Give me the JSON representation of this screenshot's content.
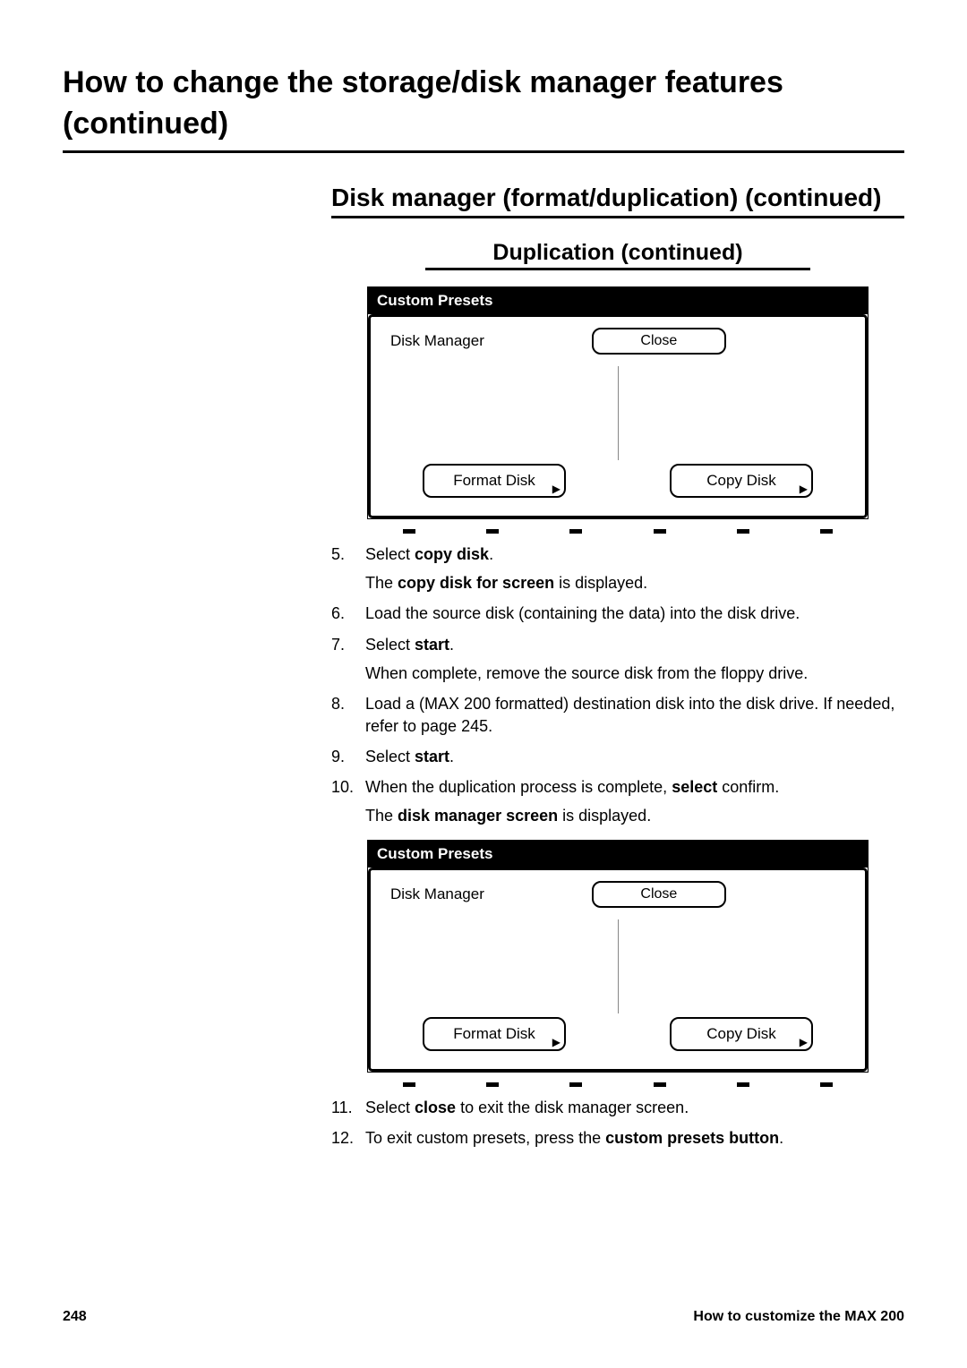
{
  "heading1": "How to change the storage/disk manager features (continued)",
  "heading2": "Disk manager (format/duplication) (continued)",
  "heading3": "Duplication (continued)",
  "dialog": {
    "title": "Custom Presets",
    "label": "Disk Manager",
    "close": "Close",
    "format": "Format Disk",
    "copy": "Copy Disk"
  },
  "steps_a": [
    {
      "n": "5.",
      "pre": "Select ",
      "bold": "copy disk",
      "post": ".",
      "sub_pre": "The ",
      "sub_bold": "copy disk for screen",
      "sub_post": " is displayed."
    },
    {
      "n": "6.",
      "pre": "Load the source disk (containing the data) into the disk drive.",
      "bold": "",
      "post": ""
    },
    {
      "n": "7.",
      "pre": "Select ",
      "bold": "start",
      "post": ".",
      "sub_plain": "When complete, remove the source disk from the floppy drive."
    },
    {
      "n": "8.",
      "pre": "Load a (MAX 200 formatted) destination disk into the disk drive. If needed, refer to page 245.",
      "bold": "",
      "post": ""
    },
    {
      "n": "9.",
      "pre": "Select ",
      "bold": "start",
      "post": "."
    },
    {
      "n": "10.",
      "pre": "When the duplication process is complete, ",
      "bold": "select",
      "post": " confirm.",
      "sub_pre": "The ",
      "sub_bold": "disk manager screen",
      "sub_post": " is displayed."
    }
  ],
  "steps_b": [
    {
      "n": "11.",
      "pre": "Select ",
      "bold": "close",
      "post": " to exit the disk manager screen."
    },
    {
      "n": "12.",
      "pre": "To exit custom presets, press the ",
      "bold": "custom presets button",
      "post": "."
    }
  ],
  "footer": {
    "page": "248",
    "section": "How to customize the MAX 200"
  }
}
